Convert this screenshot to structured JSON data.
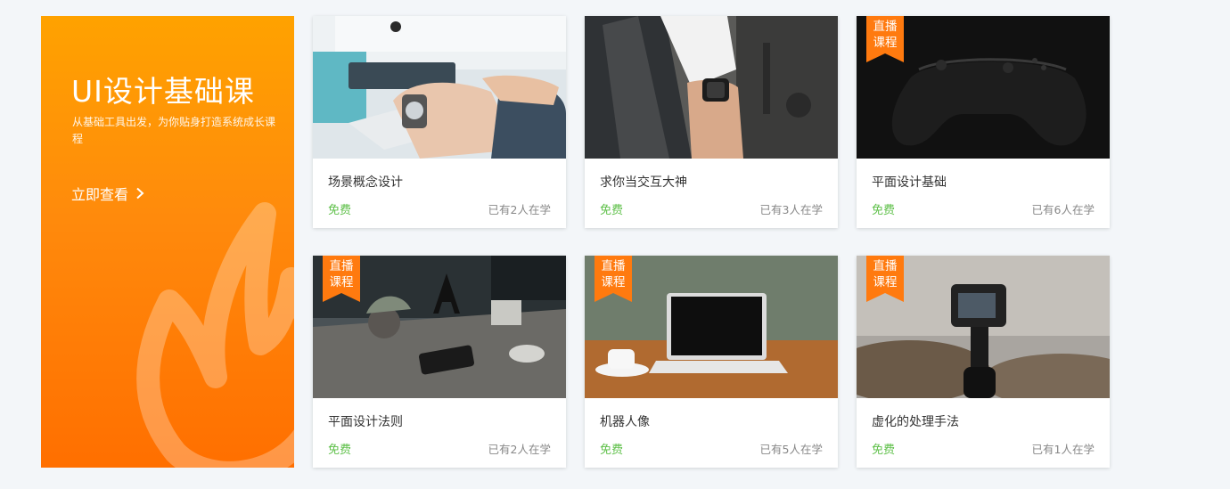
{
  "promo": {
    "title": "UI设计基础课",
    "subtitle": "从基础工具出发，为你贴身打造系统成长课程",
    "cta_label": "立即查看",
    "cta_icon": "chevron-right-icon"
  },
  "badge": {
    "line1": "直播",
    "line2": "课程",
    "color": "#ff7a0f"
  },
  "colors": {
    "accent": "#ff8a00",
    "free": "#5fc04a"
  },
  "courses": [
    {
      "title": "场景概念设计",
      "price": "免费",
      "learners": "已有2人在学",
      "live": false,
      "image": "laptop-typing-photo"
    },
    {
      "title": "求你当交互大神",
      "price": "免费",
      "learners": "已有3人在学",
      "live": false,
      "image": "smartwatch-wrist-photo"
    },
    {
      "title": "平面设计基础",
      "price": "免费",
      "learners": "已有6人在学",
      "live": true,
      "image": "game-controller-photo"
    },
    {
      "title": "平面设计法则",
      "price": "免费",
      "learners": "已有2人在学",
      "live": true,
      "image": "desk-objects-photo"
    },
    {
      "title": "机器人像",
      "price": "免费",
      "learners": "已有5人在学",
      "live": true,
      "image": "laptop-coffee-photo"
    },
    {
      "title": "虚化的处理手法",
      "price": "免费",
      "learners": "已有1人在学",
      "live": true,
      "image": "action-camera-photo"
    }
  ]
}
